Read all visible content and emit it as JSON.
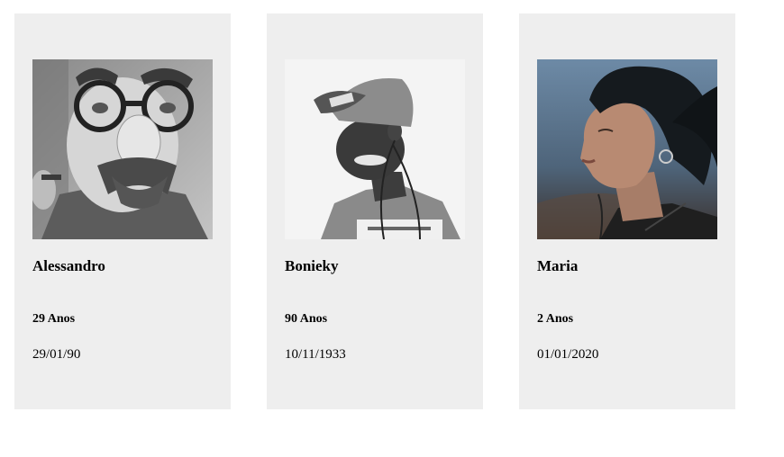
{
  "people": [
    {
      "name": "Alessandro",
      "age": "29 Anos",
      "birthdate": "29/01/90",
      "photo": "man-with-fake-glasses-nose-mustache-grayscale"
    },
    {
      "name": "Bonieky",
      "age": "90 Anos",
      "birthdate": "10/11/1933",
      "photo": "young-man-in-cap-with-earphones-grayscale"
    },
    {
      "name": "Maria",
      "age": "2 Anos",
      "birthdate": "01/01/2020",
      "photo": "woman-short-dark-hair-profile-color"
    }
  ]
}
